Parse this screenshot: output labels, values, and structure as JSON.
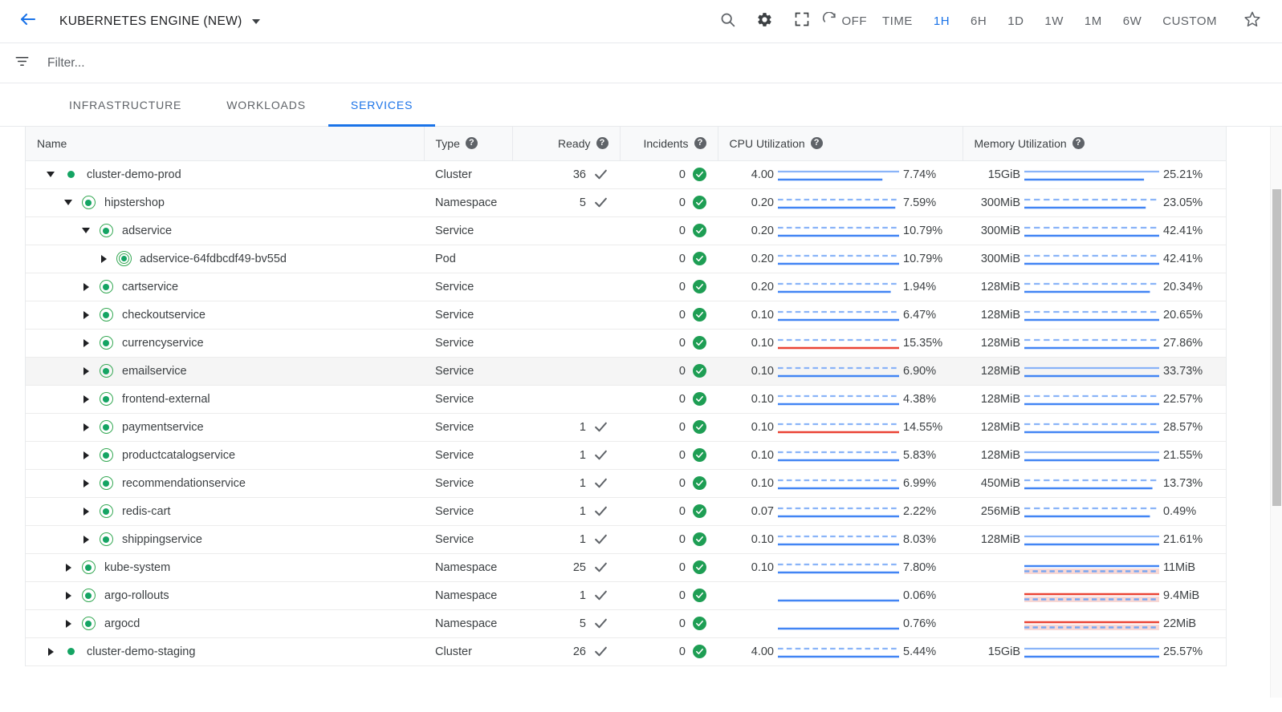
{
  "topbar": {
    "back_icon": "arrow-left-icon",
    "title": "KUBERNETES ENGINE (NEW)",
    "search_icon": "search-icon",
    "settings_icon": "gear-icon",
    "fullscreen_icon": "fullscreen-icon",
    "refresh_icon": "refresh-icon",
    "refresh_label": "OFF",
    "star_icon": "star-icon",
    "ranges": [
      {
        "label": "TIME",
        "active": false
      },
      {
        "label": "1H",
        "active": true
      },
      {
        "label": "6H",
        "active": false
      },
      {
        "label": "1D",
        "active": false
      },
      {
        "label": "1W",
        "active": false
      },
      {
        "label": "1M",
        "active": false
      },
      {
        "label": "6W",
        "active": false
      },
      {
        "label": "CUSTOM",
        "active": false
      }
    ]
  },
  "filter": {
    "icon": "filter-icon",
    "placeholder": "Filter...",
    "value": ""
  },
  "tabs": [
    {
      "label": "INFRASTRUCTURE",
      "active": false
    },
    {
      "label": "WORKLOADS",
      "active": false
    },
    {
      "label": "SERVICES",
      "active": true
    }
  ],
  "table": {
    "columns": [
      {
        "label": "Name",
        "help": false
      },
      {
        "label": "Type",
        "help": true
      },
      {
        "label": "Ready",
        "help": true
      },
      {
        "label": "Incidents",
        "help": true
      },
      {
        "label": "CPU Utilization",
        "help": true
      },
      {
        "label": "Memory Utilization",
        "help": true
      }
    ],
    "help_glyph": "?",
    "rows": [
      {
        "name": "cluster-demo-prod",
        "indent": 0,
        "expanded": true,
        "icon": "status-dot-green",
        "type": "Cluster",
        "ready": "36",
        "ready_check": true,
        "incidents": "0",
        "incident_ok": true,
        "cpu": {
          "limit": "4.00",
          "pct": "7.74%",
          "usage_ratio": 0.86,
          "usage_color": "#4285f4",
          "limit_dashed": false
        },
        "mem": {
          "limit": "15GiB",
          "pct": "25.21%",
          "usage_ratio": 0.89,
          "usage_color": "#4285f4",
          "limit_dashed": false
        }
      },
      {
        "name": "hipstershop",
        "indent": 1,
        "expanded": true,
        "icon": "status-ring-green",
        "type": "Namespace",
        "ready": "5",
        "ready_check": true,
        "incidents": "0",
        "incident_ok": true,
        "cpu": {
          "limit": "0.20",
          "pct": "7.59%",
          "usage_ratio": 0.97,
          "usage_color": "#4285f4",
          "limit_dashed": true
        },
        "mem": {
          "limit": "300MiB",
          "pct": "23.05%",
          "usage_ratio": 0.9,
          "usage_color": "#4285f4",
          "limit_dashed": true
        }
      },
      {
        "name": "adservice",
        "indent": 2,
        "expanded": true,
        "icon": "status-ring-green",
        "type": "Service",
        "ready": "",
        "ready_check": false,
        "incidents": "0",
        "incident_ok": true,
        "cpu": {
          "limit": "0.20",
          "pct": "10.79%",
          "usage_ratio": 1.0,
          "usage_color": "#4285f4",
          "limit_dashed": true
        },
        "mem": {
          "limit": "300MiB",
          "pct": "42.41%",
          "usage_ratio": 1.0,
          "usage_color": "#4285f4",
          "limit_dashed": true
        }
      },
      {
        "name": "adservice-64fdbcdf49-bv55d",
        "indent": 3,
        "expanded": false,
        "icon": "status-ring2-green",
        "type": "Pod",
        "ready": "",
        "ready_check": false,
        "incidents": "0",
        "incident_ok": true,
        "cpu": {
          "limit": "0.20",
          "pct": "10.79%",
          "usage_ratio": 1.0,
          "usage_color": "#4285f4",
          "limit_dashed": true
        },
        "mem": {
          "limit": "300MiB",
          "pct": "42.41%",
          "usage_ratio": 1.0,
          "usage_color": "#4285f4",
          "limit_dashed": true
        }
      },
      {
        "name": "cartservice",
        "indent": 2,
        "expanded": false,
        "icon": "status-ring-green",
        "type": "Service",
        "ready": "",
        "ready_check": false,
        "incidents": "0",
        "incident_ok": true,
        "cpu": {
          "limit": "0.20",
          "pct": "1.94%",
          "usage_ratio": 0.93,
          "usage_color": "#4285f4",
          "limit_dashed": true
        },
        "mem": {
          "limit": "128MiB",
          "pct": "20.34%",
          "usage_ratio": 0.93,
          "usage_color": "#4285f4",
          "limit_dashed": true
        }
      },
      {
        "name": "checkoutservice",
        "indent": 2,
        "expanded": false,
        "icon": "status-ring-green",
        "type": "Service",
        "ready": "",
        "ready_check": false,
        "incidents": "0",
        "incident_ok": true,
        "cpu": {
          "limit": "0.10",
          "pct": "6.47%",
          "usage_ratio": 1.0,
          "usage_color": "#4285f4",
          "limit_dashed": true
        },
        "mem": {
          "limit": "128MiB",
          "pct": "20.65%",
          "usage_ratio": 1.0,
          "usage_color": "#4285f4",
          "limit_dashed": true
        }
      },
      {
        "name": "currencyservice",
        "indent": 2,
        "expanded": false,
        "icon": "status-ring-green",
        "type": "Service",
        "ready": "",
        "ready_check": false,
        "incidents": "0",
        "incident_ok": true,
        "cpu": {
          "limit": "0.10",
          "pct": "15.35%",
          "usage_ratio": 1.0,
          "usage_color": "#ea4335",
          "limit_dashed": true
        },
        "mem": {
          "limit": "128MiB",
          "pct": "27.86%",
          "usage_ratio": 1.0,
          "usage_color": "#4285f4",
          "limit_dashed": true
        }
      },
      {
        "name": "emailservice",
        "indent": 2,
        "expanded": false,
        "icon": "status-ring-green",
        "hovered": true,
        "type": "Service",
        "ready": "",
        "ready_check": false,
        "incidents": "0",
        "incident_ok": true,
        "cpu": {
          "limit": "0.10",
          "pct": "6.90%",
          "usage_ratio": 1.0,
          "usage_color": "#4285f4",
          "limit_dashed": true
        },
        "mem": {
          "limit": "128MiB",
          "pct": "33.73%",
          "usage_ratio": 1.0,
          "usage_color": "#4285f4",
          "limit_dashed": false
        }
      },
      {
        "name": "frontend-external",
        "indent": 2,
        "expanded": false,
        "icon": "status-ring-green",
        "type": "Service",
        "ready": "",
        "ready_check": false,
        "incidents": "0",
        "incident_ok": true,
        "cpu": {
          "limit": "0.10",
          "pct": "4.38%",
          "usage_ratio": 1.0,
          "usage_color": "#4285f4",
          "limit_dashed": true
        },
        "mem": {
          "limit": "128MiB",
          "pct": "22.57%",
          "usage_ratio": 1.0,
          "usage_color": "#4285f4",
          "limit_dashed": true
        }
      },
      {
        "name": "paymentservice",
        "indent": 2,
        "expanded": false,
        "icon": "status-ring-green",
        "type": "Service",
        "ready": "1",
        "ready_check": true,
        "incidents": "0",
        "incident_ok": true,
        "cpu": {
          "limit": "0.10",
          "pct": "14.55%",
          "usage_ratio": 1.0,
          "usage_color": "#ea4335",
          "limit_dashed": true
        },
        "mem": {
          "limit": "128MiB",
          "pct": "28.57%",
          "usage_ratio": 1.0,
          "usage_color": "#4285f4",
          "limit_dashed": true
        }
      },
      {
        "name": "productcatalogservice",
        "indent": 2,
        "expanded": false,
        "icon": "status-ring-green",
        "type": "Service",
        "ready": "1",
        "ready_check": true,
        "incidents": "0",
        "incident_ok": true,
        "cpu": {
          "limit": "0.10",
          "pct": "5.83%",
          "usage_ratio": 1.0,
          "usage_color": "#4285f4",
          "limit_dashed": true
        },
        "mem": {
          "limit": "128MiB",
          "pct": "21.55%",
          "usage_ratio": 1.0,
          "usage_color": "#4285f4",
          "limit_dashed": false
        }
      },
      {
        "name": "recommendationservice",
        "indent": 2,
        "expanded": false,
        "icon": "status-ring-green",
        "type": "Service",
        "ready": "1",
        "ready_check": true,
        "incidents": "0",
        "incident_ok": true,
        "cpu": {
          "limit": "0.10",
          "pct": "6.99%",
          "usage_ratio": 1.0,
          "usage_color": "#4285f4",
          "limit_dashed": true
        },
        "mem": {
          "limit": "450MiB",
          "pct": "13.73%",
          "usage_ratio": 0.95,
          "usage_color": "#4285f4",
          "limit_dashed": true
        }
      },
      {
        "name": "redis-cart",
        "indent": 2,
        "expanded": false,
        "icon": "status-ring-green",
        "type": "Service",
        "ready": "1",
        "ready_check": true,
        "incidents": "0",
        "incident_ok": true,
        "cpu": {
          "limit": "0.07",
          "pct": "2.22%",
          "usage_ratio": 1.0,
          "usage_color": "#4285f4",
          "limit_dashed": true
        },
        "mem": {
          "limit": "256MiB",
          "pct": "0.49%",
          "usage_ratio": 0.93,
          "usage_color": "#4285f4",
          "limit_dashed": true
        }
      },
      {
        "name": "shippingservice",
        "indent": 2,
        "expanded": false,
        "icon": "status-ring-green",
        "type": "Service",
        "ready": "1",
        "ready_check": true,
        "incidents": "0",
        "incident_ok": true,
        "cpu": {
          "limit": "0.10",
          "pct": "8.03%",
          "usage_ratio": 1.0,
          "usage_color": "#4285f4",
          "limit_dashed": true
        },
        "mem": {
          "limit": "128MiB",
          "pct": "21.61%",
          "usage_ratio": 1.0,
          "usage_color": "#4285f4",
          "limit_dashed": false
        }
      },
      {
        "name": "kube-system",
        "indent": 1,
        "expanded": false,
        "icon": "status-ring-green",
        "type": "Namespace",
        "ready": "25",
        "ready_check": true,
        "incidents": "0",
        "incident_ok": true,
        "cpu": {
          "limit": "0.10",
          "pct": "7.80%",
          "usage_ratio": 1.0,
          "usage_color": "#4285f4",
          "limit_dashed": true
        },
        "mem": {
          "limit": "",
          "pct": "11MiB",
          "usage_ratio": 1.0,
          "usage_color": "#4285f4",
          "limit_dashed": false,
          "band": "red",
          "dual": true
        }
      },
      {
        "name": "argo-rollouts",
        "indent": 1,
        "expanded": false,
        "icon": "status-ring-green",
        "type": "Namespace",
        "ready": "1",
        "ready_check": true,
        "incidents": "0",
        "incident_ok": true,
        "cpu": {
          "limit": "",
          "pct": "0.06%",
          "usage_ratio": 1.0,
          "usage_color": "#4285f4",
          "limit_dashed": false,
          "no_limit": true
        },
        "mem": {
          "limit": "",
          "pct": "9.4MiB",
          "usage_ratio": 1.0,
          "usage_color": "#ea4335",
          "limit_dashed": false,
          "band": "red",
          "dual": true
        }
      },
      {
        "name": "argocd",
        "indent": 1,
        "expanded": false,
        "icon": "status-ring-green",
        "type": "Namespace",
        "ready": "5",
        "ready_check": true,
        "incidents": "0",
        "incident_ok": true,
        "cpu": {
          "limit": "",
          "pct": "0.76%",
          "usage_ratio": 1.0,
          "usage_color": "#4285f4",
          "limit_dashed": false,
          "no_limit": true
        },
        "mem": {
          "limit": "",
          "pct": "22MiB",
          "usage_ratio": 1.0,
          "usage_color": "#ea4335",
          "limit_dashed": false,
          "band": "red",
          "dual": true
        }
      },
      {
        "name": "cluster-demo-staging",
        "indent": 0,
        "expanded": false,
        "icon": "status-dot-green",
        "type": "Cluster",
        "ready": "26",
        "ready_check": true,
        "incidents": "0",
        "incident_ok": true,
        "cpu": {
          "limit": "4.00",
          "pct": "5.44%",
          "usage_ratio": 1.0,
          "usage_color": "#4285f4",
          "limit_dashed": true
        },
        "mem": {
          "limit": "15GiB",
          "pct": "25.57%",
          "usage_ratio": 1.0,
          "usage_color": "#4285f4",
          "limit_dashed": false
        }
      }
    ]
  },
  "colors": {
    "accent_blue": "#1a73e8",
    "chart_blue": "#4285f4",
    "chart_red": "#ea4335",
    "status_green": "#1e9e54",
    "text_primary": "#3c4043",
    "text_secondary": "#5f6368",
    "border": "#e8eaed"
  },
  "scrollbar": {
    "orientation": "vertical"
  }
}
